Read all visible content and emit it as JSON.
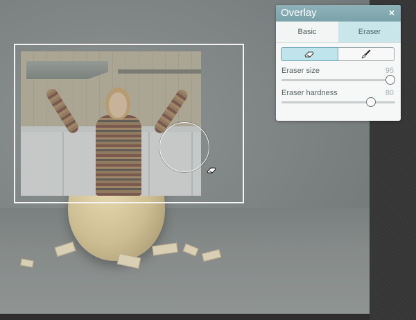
{
  "panel": {
    "title": "Overlay",
    "close_label": "×",
    "tabs": [
      {
        "label": "Basic",
        "active": false
      },
      {
        "label": "Eraser",
        "active": true
      }
    ],
    "tools": [
      {
        "icon": "eraser-icon",
        "active": true
      },
      {
        "icon": "brush-icon",
        "active": false
      }
    ],
    "sliders": [
      {
        "label": "Eraser size",
        "value": "95",
        "fraction": 0.95
      },
      {
        "label": "Eraser hardness",
        "value": "80",
        "fraction": 0.78
      }
    ]
  },
  "colors": {
    "header": "#7aa2aa",
    "active_tab": "#c9e6ea",
    "active_tool": "#bfe4eb"
  }
}
